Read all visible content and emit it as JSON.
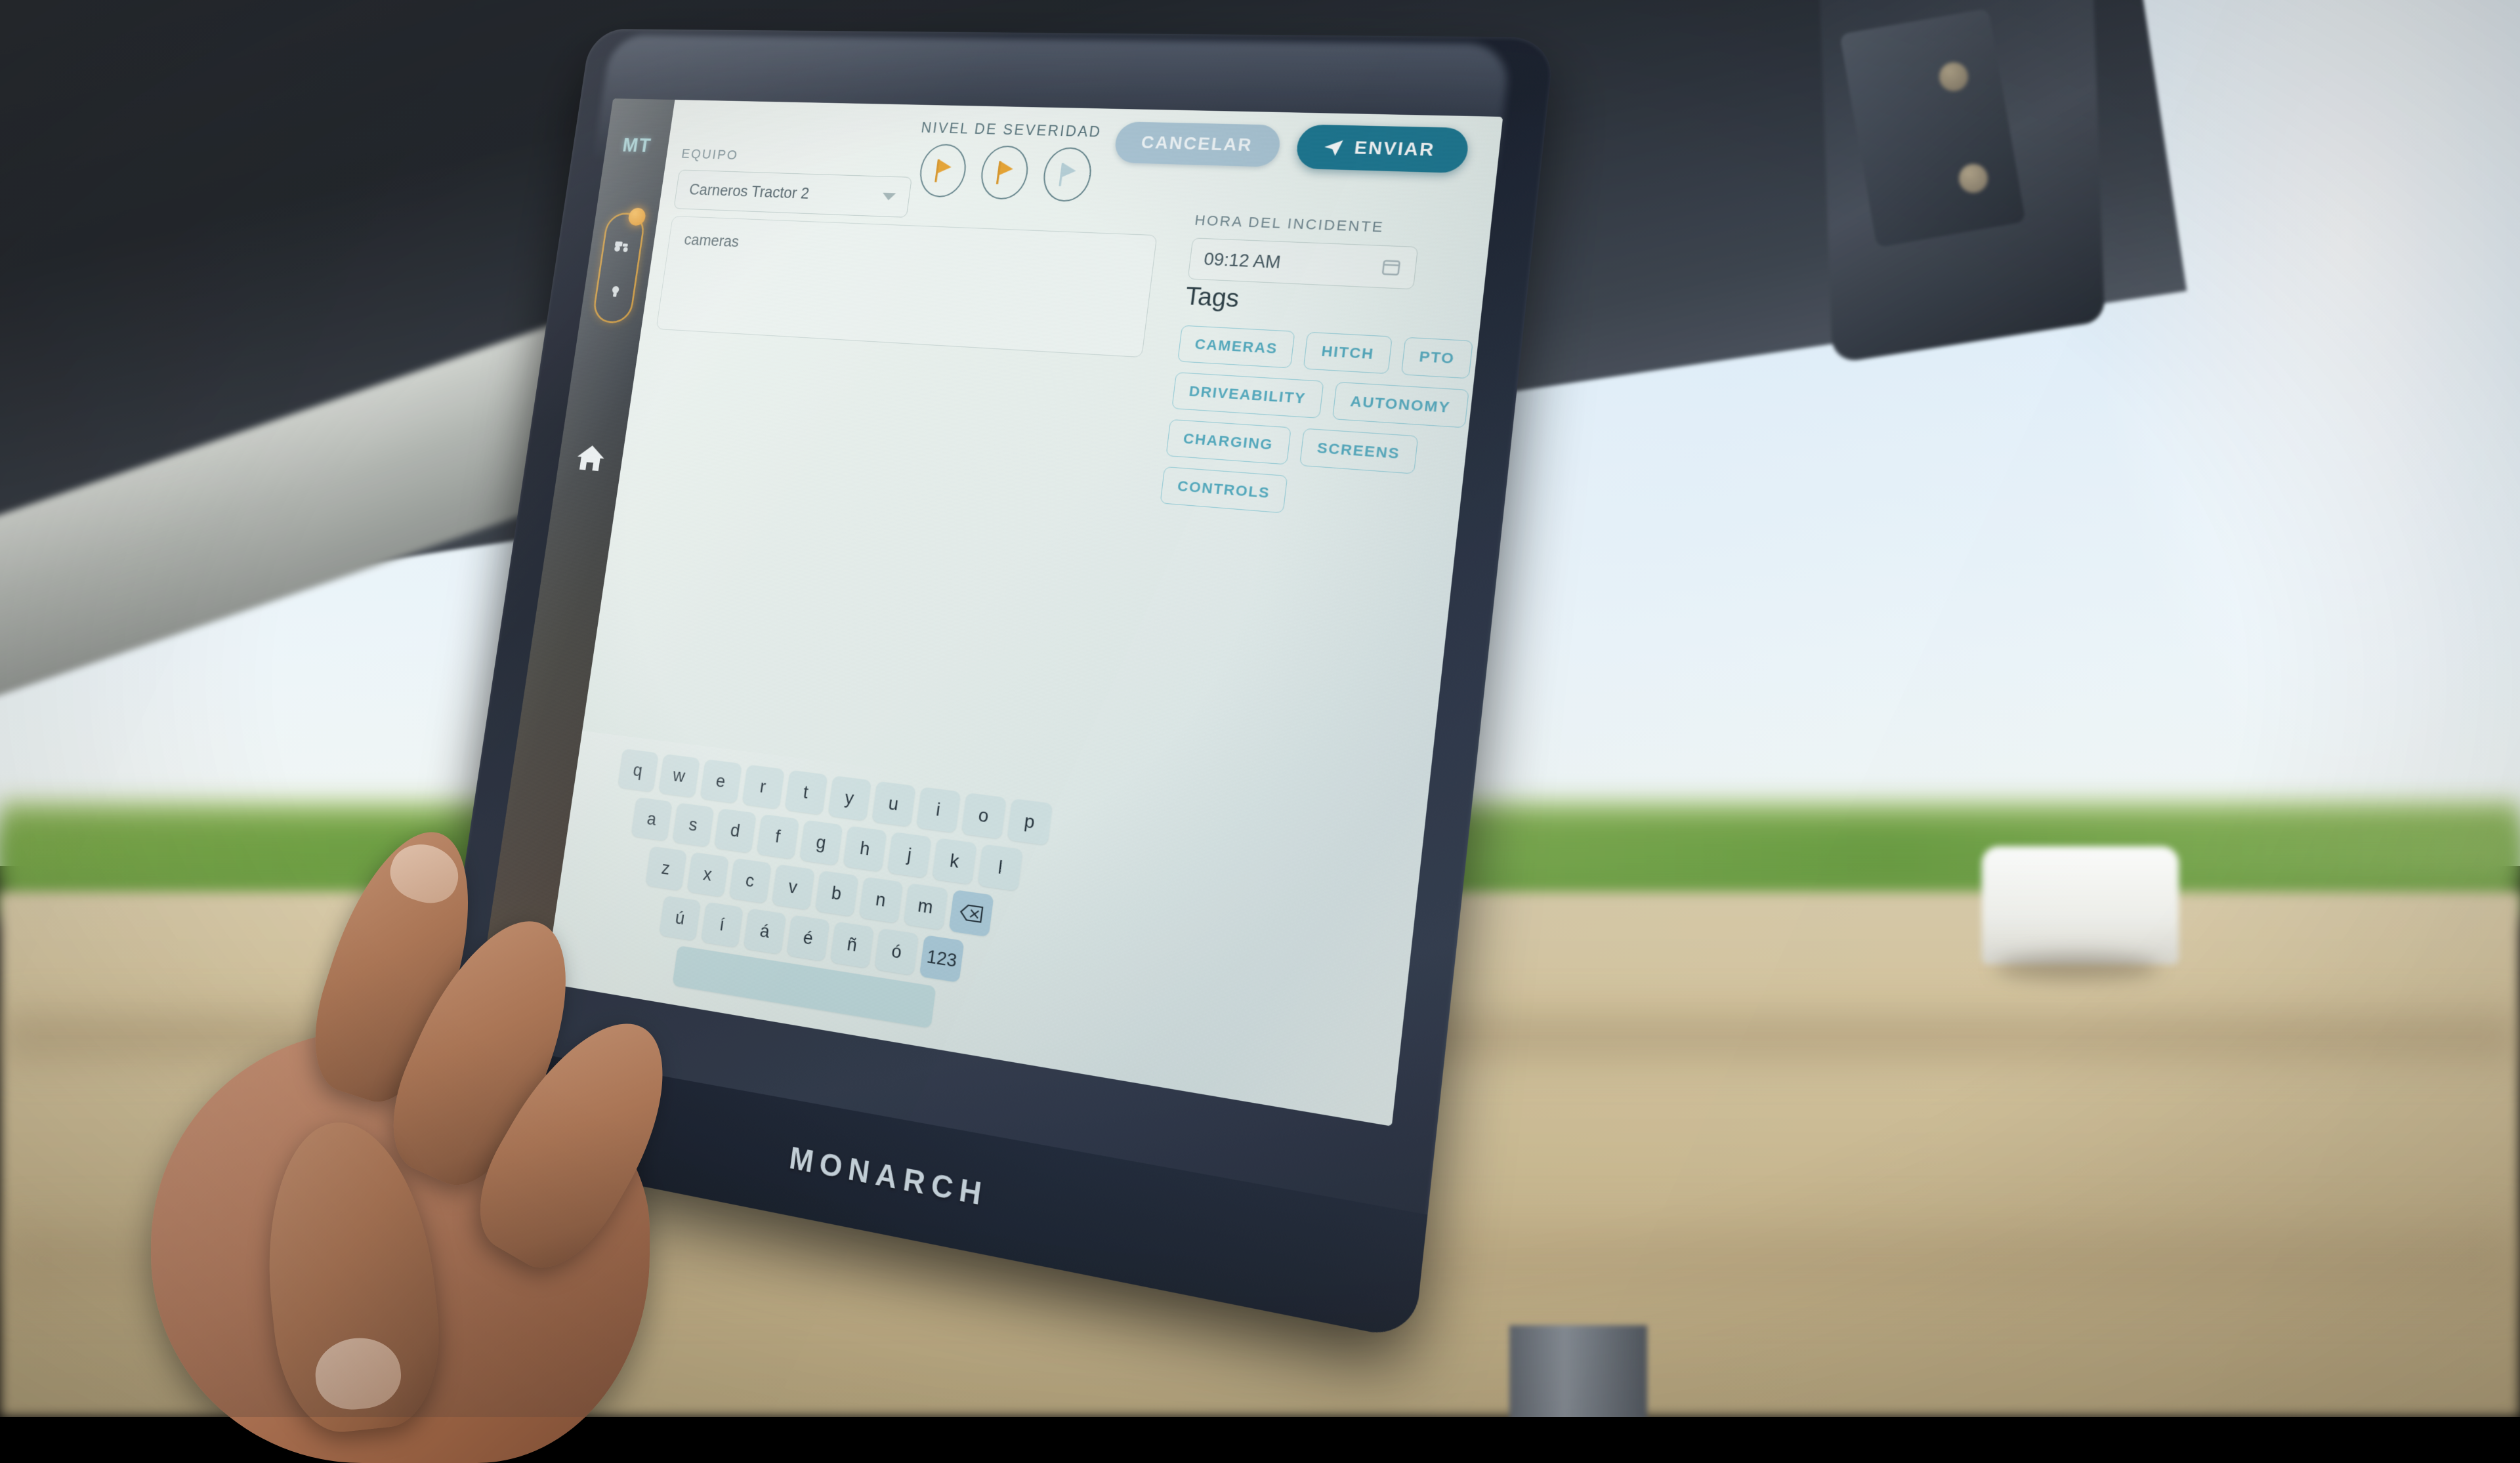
{
  "device": {
    "brand": "MONARCH"
  },
  "sidebar": {
    "avatar_initials": "MT",
    "items": [
      {
        "name": "tractor-status",
        "icon": "tractor-icon"
      },
      {
        "name": "implement-status",
        "icon": "implement-icon"
      },
      {
        "name": "home",
        "icon": "home-icon"
      }
    ]
  },
  "toolbar": {
    "cancel_label": "CANCELAR",
    "send_label": "ENVIAR",
    "send_icon": "paper-plane-icon"
  },
  "severity": {
    "label": "NIVEL DE SEVERIDAD",
    "options": [
      {
        "value": 1,
        "icon": "flag-icon",
        "selected": true
      },
      {
        "value": 2,
        "icon": "flag-icon",
        "selected": true
      },
      {
        "value": 3,
        "icon": "flag-icon",
        "selected": false
      }
    ]
  },
  "equipo": {
    "label": "EQUIPO",
    "value": "Carneros Tractor 2",
    "icon": "chevron-down-icon"
  },
  "description": {
    "value": "cameras",
    "placeholder": ""
  },
  "hora": {
    "label": "HORA DEL INCIDENTE",
    "value": "09:12 AM",
    "icon": "calendar-icon"
  },
  "tags": {
    "title": "Tags",
    "items": [
      "CAMERAS",
      "HITCH",
      "PTO",
      "DRIVEABILITY",
      "AUTONOMY",
      "CHARGING",
      "SCREENS",
      "CONTROLS"
    ]
  },
  "keyboard": {
    "rows": [
      [
        "q",
        "w",
        "e",
        "r",
        "t",
        "y",
        "u",
        "i",
        "o",
        "p"
      ],
      [
        "a",
        "s",
        "d",
        "f",
        "g",
        "h",
        "j",
        "k",
        "l"
      ],
      [
        "z",
        "x",
        "c",
        "v",
        "b",
        "n",
        "m",
        "⌫"
      ],
      [
        "ú",
        "í",
        "á",
        "é",
        "ñ",
        "ó",
        "123"
      ],
      [
        " "
      ]
    ],
    "backspace_label": "⌫",
    "numeric_label": "123",
    "space_label": " "
  },
  "colors": {
    "accent_send": "#15738e",
    "accent_cancel": "#a9c4d4",
    "tag_border": "#8fc9d4",
    "tag_text": "#4fa7bb",
    "flag_active": "#e8a028",
    "flag_inactive": "#b6cfd6",
    "screen_bg": "#e9f1ec",
    "sidebar_accent": "#c98a1e",
    "avatar_text": "#9dd4d8"
  }
}
